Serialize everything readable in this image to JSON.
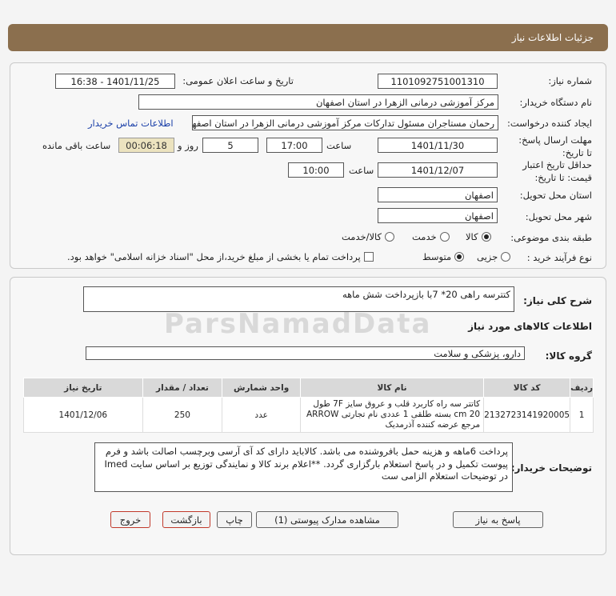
{
  "header": {
    "title": "جزئیات اطلاعات نیاز"
  },
  "fields": {
    "need_number_label": "شماره نیاز:",
    "need_number": "1101092751001310",
    "announce_label": "تاریخ و ساعت اعلان عمومی:",
    "announce_value": "1401/11/25 - 16:38",
    "buyer_org_label": "نام دستگاه خریدار:",
    "buyer_org": "مرکز آموزشی درمانی الزهرا در استان اصفهان",
    "requester_label": "ایجاد کننده درخواست:",
    "requester": "رحمان مستاجران مسئول تدارکات مرکز آموزشی درمانی الزهرا در استان اصفهان",
    "contact_link": "اطلاعات تماس خریدار",
    "reply_deadline_label": "مهلت ارسال پاسخ: تا تاریخ:",
    "reply_date": "1401/11/30",
    "time_label": "ساعت",
    "reply_time": "17:00",
    "days_value": "5",
    "days_label": "روز و",
    "remaining_value": "00:06:18",
    "remaining_label": "ساعت باقی مانده",
    "validity_label": "حداقل تاریخ اعتبار قیمت: تا تاریخ:",
    "validity_date": "1401/12/07",
    "validity_time": "10:00",
    "delivery_province_label": "استان محل تحویل:",
    "delivery_province": "اصفهان",
    "delivery_city_label": "شهر محل تحویل:",
    "delivery_city": "اصفهان",
    "category_label": "طبقه بندی موضوعی:",
    "category_options": [
      "کالا",
      "خدمت",
      "کالا/خدمت"
    ],
    "purchase_type_label": "نوع فرآیند خرید :",
    "purchase_options": [
      "جزیی",
      "متوسط"
    ],
    "payment_note": "پرداخت تمام یا بخشی از مبلغ خرید،از محل \"اسناد خزانه اسلامی\" خواهد بود."
  },
  "summary": {
    "label": "شرح کلی نیاز:",
    "value": "کتترسه راهی 20* 7با بازپرداخت شش ماهه"
  },
  "goods": {
    "section_title": "اطلاعات کالاهای مورد نیاز",
    "group_label": "گروه کالا:",
    "group_value": "دارو، پزشکی و سلامت",
    "columns": [
      "ردیف",
      "کد کالا",
      "نام کالا",
      "واحد شمارش",
      "تعداد / مقدار",
      "تاریخ نیاز"
    ],
    "rows": [
      {
        "row": "1",
        "code": "2132723141920005",
        "name": "کاتتر سه راه کاربرد قلب و عروق سایز 7F طول 20 cm بسته طلقی 1 عددی نام تجارتی ARROW مرجع عرضه کننده آذرمدیک",
        "unit": "عدد",
        "qty": "250",
        "date": "1401/12/06"
      }
    ]
  },
  "buyer_notes": {
    "label": "توضیحات خریدار:",
    "value": "پرداخت 6ماهه و هزینه حمل بافروشنده می باشد. کالاباید دارای کد آی آرسی وبرچسب اصالت باشد و فرم پیوست تکمیل و در پاسخ استعلام بارگزاری گردد. **اعلام برند کالا و نمایندگی توزیع بر اساس سایت Imed در توضیحات استعلام الزامی ست"
  },
  "buttons": {
    "reply": "پاسخ به نیاز",
    "attachments": "مشاهده مدارک پیوستی (1)",
    "print": "چاپ",
    "back": "بازگشت",
    "exit": "خروج"
  },
  "watermark": "ParsNamadData"
}
